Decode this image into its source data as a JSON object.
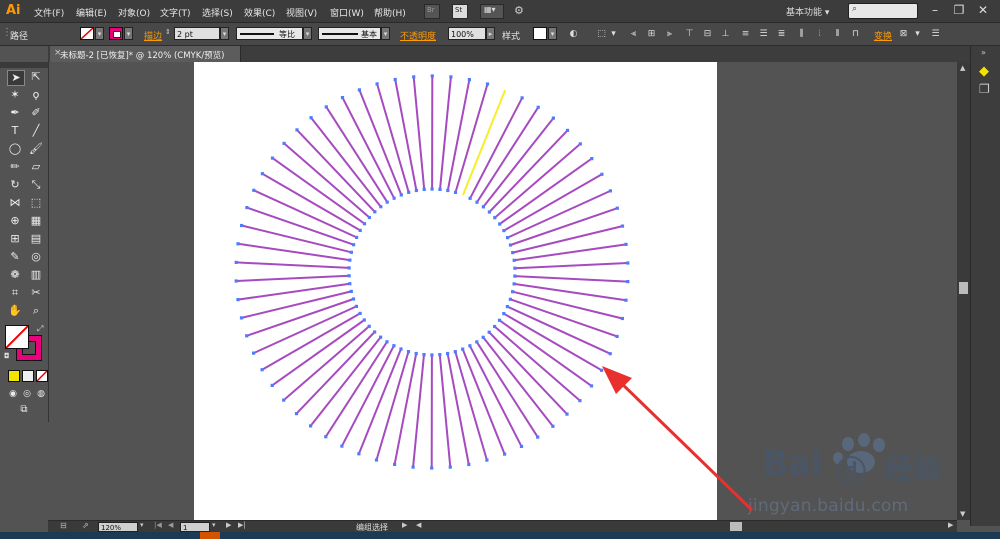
{
  "app": {
    "logo": "Ai"
  },
  "menu": [
    "文件(F)",
    "编辑(E)",
    "对象(O)",
    "文字(T)",
    "选择(S)",
    "效果(C)",
    "视图(V)",
    "窗口(W)",
    "帮助(H)"
  ],
  "menu_extra": {
    "br": "Br",
    "st": "St"
  },
  "workspace": {
    "label": "基本功能",
    "caret": "▾"
  },
  "search": {
    "placeholder": "",
    "icon": "search-icon"
  },
  "window_controls": {
    "minimize": "–",
    "restore": "❐",
    "close": "✕"
  },
  "control_bar": {
    "selection_label": "路径",
    "stroke_label": "描边",
    "stroke_value": "2 pt",
    "profile_label": "等比",
    "brush_label": "基本",
    "opacity_label": "不透明度",
    "opacity_value": "100%",
    "style_label": "样式",
    "transform_label": "变换"
  },
  "document_tab": {
    "title": "未标题-2 [已恢复]* @ 120% (CMYK/预览)",
    "close": "×"
  },
  "status": {
    "zoom": "120%",
    "page": "1",
    "mode": "编组选择"
  },
  "colors": {
    "line": "#a64bbf",
    "anchor": "#4f7bff",
    "highlight": "#f7ee2a",
    "arrow": "#e8302e",
    "fill_swatch": "#e8007d"
  },
  "artwork": {
    "spoke_count": 66,
    "highlighted_spoke_index": 2
  },
  "watermark": {
    "brand": "Bai",
    "suffix": "经验",
    "url": "jingyan.baidu.com"
  }
}
